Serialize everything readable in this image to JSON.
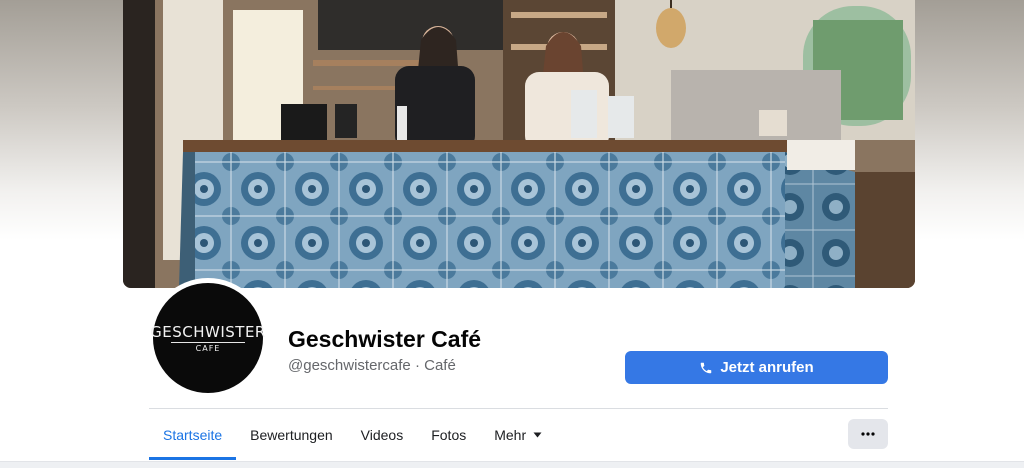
{
  "header": {
    "page_name": "Geschwister Café",
    "handle_category": "@geschwistercafe · Café"
  },
  "cover": {
    "image_subject": "cafe-counter-photo"
  },
  "profile": {
    "logo_text": "GESCHWISTER",
    "logo_subtext": "CAFE"
  },
  "actions": {
    "call_label": "Jetzt anrufen",
    "call_icon": "phone-icon",
    "more_icon": "ellipsis-icon"
  },
  "tabs": [
    {
      "label": "Startseite",
      "active": true
    },
    {
      "label": "Bewertungen",
      "active": false
    },
    {
      "label": "Videos",
      "active": false
    },
    {
      "label": "Fotos",
      "active": false
    },
    {
      "label": "Mehr",
      "active": false,
      "has_dropdown": true
    }
  ],
  "colors": {
    "primary_blue": "#3578e5",
    "active_tab": "#1b74e4",
    "secondary_text": "#65676b"
  }
}
